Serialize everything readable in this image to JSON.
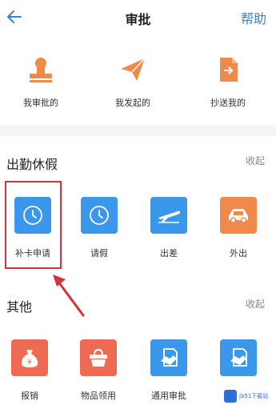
{
  "header": {
    "title": "审批",
    "help_label": "帮助"
  },
  "quick": [
    {
      "label": "我审批的",
      "icon": "stamp-icon"
    },
    {
      "label": "我发起的",
      "icon": "paper-plane-icon"
    },
    {
      "label": "抄送我的",
      "icon": "document-forward-icon"
    }
  ],
  "attendance": {
    "title": "出勤休假",
    "collapse_label": "收起",
    "items": [
      {
        "label": "补卡申请",
        "icon": "clock-icon"
      },
      {
        "label": "请假",
        "icon": "clock-icon"
      },
      {
        "label": "出差",
        "icon": "airplane-icon"
      },
      {
        "label": "外出",
        "icon": "car-icon"
      }
    ]
  },
  "other": {
    "title": "其他",
    "collapse_label": "收起",
    "items": [
      {
        "label": "报销",
        "icon": "money-bag-icon"
      },
      {
        "label": "物品领用",
        "icon": "basket-icon"
      },
      {
        "label": "通用审批",
        "icon": "handshake-document-icon"
      },
      {
        "label": "",
        "icon": "handshake-document-icon"
      }
    ]
  },
  "watermark": {
    "text": "jb51下载站",
    "logo": "watermark-logo"
  },
  "colors": {
    "accent": "#2c86de",
    "icon_blue": "#3a97ea",
    "icon_orange": "#f08a4b",
    "icon_red": "#ee6a52",
    "highlight": "#d9313a"
  }
}
